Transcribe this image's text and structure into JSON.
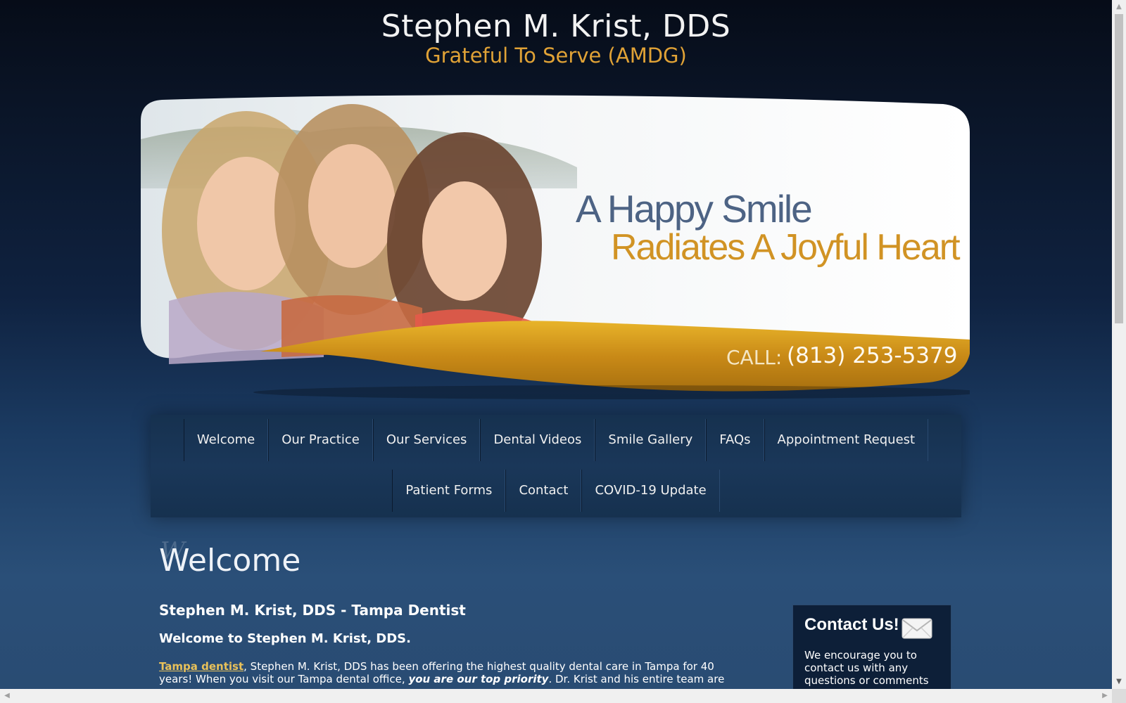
{
  "header": {
    "title": "Stephen M. Krist, DDS",
    "tagline": "Grateful To Serve (AMDG)"
  },
  "banner": {
    "line1": "A Happy Smile",
    "line2": "Radiates A Joyful Heart",
    "call_label": "CALL:",
    "phone": "(813) 253-5379"
  },
  "nav": {
    "row1": [
      {
        "label": "Welcome"
      },
      {
        "label": "Our Practice"
      },
      {
        "label": "Our Services"
      },
      {
        "label": "Dental Videos"
      },
      {
        "label": "Smile Gallery"
      },
      {
        "label": "FAQs"
      },
      {
        "label": "Appointment Request"
      }
    ],
    "row2": [
      {
        "label": "Patient Forms"
      },
      {
        "label": "Contact"
      },
      {
        "label": "COVID-19 Update"
      }
    ]
  },
  "content": {
    "page_heading": "Welcome",
    "heading_deco": "W",
    "subheading": "Stephen M. Krist, DDS - Tampa Dentist",
    "welcome_line": "Welcome to Stephen M. Krist, DDS.",
    "link_text": "Tampa dentist",
    "para_part1": ", Stephen M. Krist, DDS has been offering the highest quality dental care in Tampa for 40 years! When you visit our Tampa dental office, ",
    "para_emphasis": "you are our top priority",
    "para_part2": ".  Dr. Krist and his entire team are"
  },
  "contact_box": {
    "title": "Contact Us!",
    "text": "We encourage you to contact us with any questions or comments"
  },
  "colors": {
    "accent_gold": "#d19324",
    "banner_blue": "#4d6384",
    "link": "#e8c15a"
  }
}
